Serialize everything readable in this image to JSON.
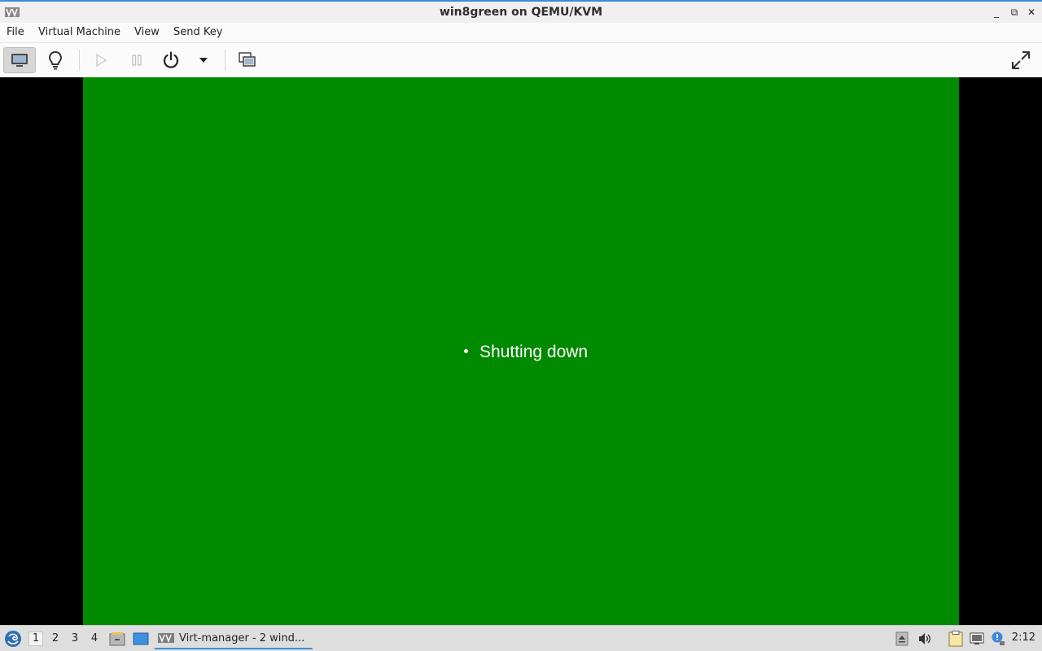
{
  "window": {
    "title": "win8green on QEMU/KVM",
    "controls": {
      "minimize": "_",
      "restore": "⧉",
      "close": "✕"
    }
  },
  "menu": [
    "File",
    "Virtual Machine",
    "View",
    "Send Key"
  ],
  "toolbar": {
    "buttons": [
      {
        "icon": "console-icon",
        "active": true
      },
      {
        "icon": "details-lightbulb-icon"
      },
      {
        "icon": "run-icon",
        "disabled": true
      },
      {
        "icon": "pause-icon",
        "disabled": true
      },
      {
        "icon": "power-icon"
      },
      {
        "icon": "dropdown-arrow-icon"
      },
      {
        "icon": "snapshots-icon"
      },
      {
        "icon": "fullscreen-icon"
      }
    ]
  },
  "guest": {
    "background": "#008a00",
    "status_text": "Shutting down"
  },
  "taskbar": {
    "workspaces": [
      "1",
      "2",
      "3",
      "4"
    ],
    "active_workspace": "1",
    "task_label": "Virt-manager - 2 wind...",
    "clock": "2:12"
  }
}
